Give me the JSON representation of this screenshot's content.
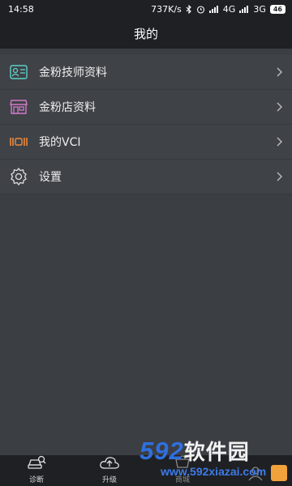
{
  "status_bar": {
    "time": "14:58",
    "net_speed": "737K/s",
    "network_1": "4G",
    "network_2": "3G",
    "battery": "46"
  },
  "header": {
    "title": "我的"
  },
  "menu": [
    {
      "label": "金粉技师资料",
      "icon": "technician-card-icon",
      "color": "#5fd0c8"
    },
    {
      "label": "金粉店资料",
      "icon": "storefront-icon",
      "color": "#d07ac8"
    },
    {
      "label": "我的VCI",
      "icon": "vci-device-icon",
      "color": "#f08a3c"
    },
    {
      "label": "设置",
      "icon": "gear-icon",
      "color": "#e0e0e0"
    }
  ],
  "tab_bar": [
    {
      "label": "诊断",
      "icon": "car-diagnose-icon"
    },
    {
      "label": "升级",
      "icon": "cloud-upgrade-icon"
    },
    {
      "label": "商城",
      "icon": "mall-icon"
    },
    {
      "label": "",
      "icon": "profile-icon"
    }
  ],
  "watermark": {
    "brand": "592",
    "brand_cn": "软件园",
    "url": "www.592xiazai.com"
  },
  "colors": {
    "header_bg": "#1f2023",
    "page_bg": "#3b3e43",
    "row_bg": "#3f4247",
    "watermark_blue": "#2f6fe0"
  }
}
